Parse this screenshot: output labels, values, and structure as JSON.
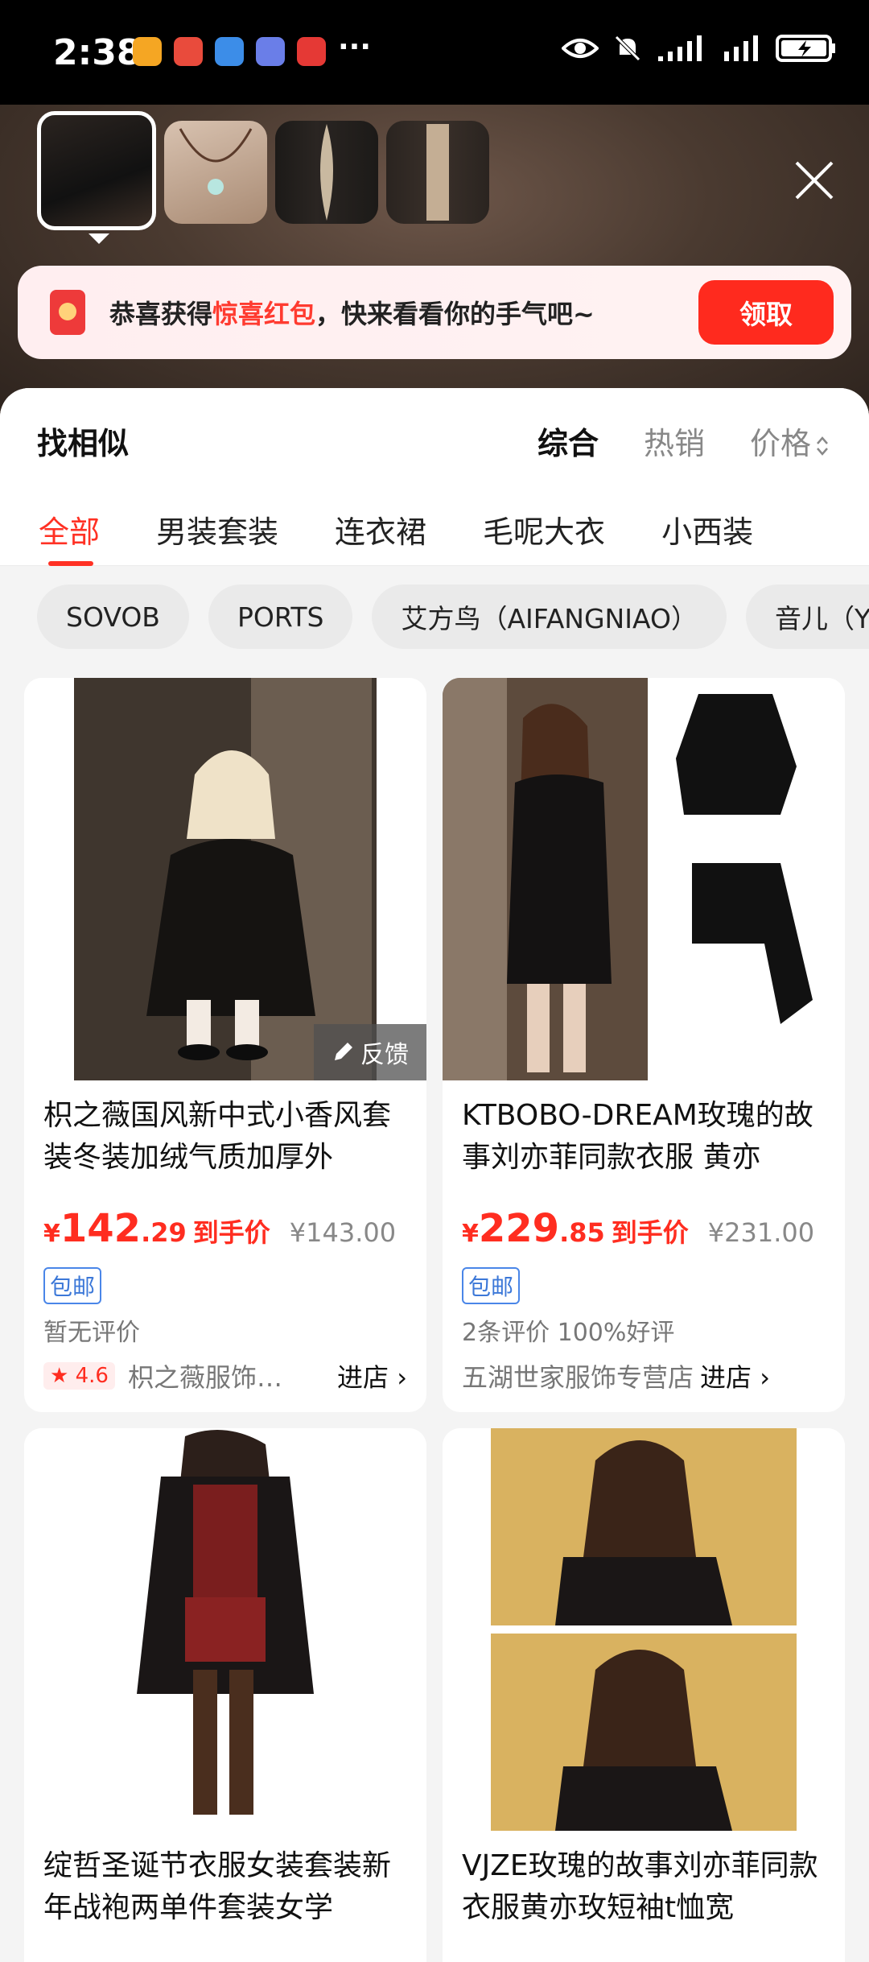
{
  "status_bar": {
    "time": "2:38",
    "more": "···",
    "battery_icon": "battery-charging-icon"
  },
  "thumbnails": [
    {
      "name": "black-outfit"
    },
    {
      "name": "necklace"
    },
    {
      "name": "leaf-pin"
    },
    {
      "name": "bracelet"
    }
  ],
  "promo": {
    "text_before": "恭喜获得",
    "highlight": "惊喜红包",
    "text_after": "，快来看看你的手气吧~",
    "button": "领取",
    "accent": "#ff2a1e"
  },
  "sheet": {
    "title": "找相似",
    "sorts": [
      "综合",
      "热销",
      "价格"
    ],
    "categories": [
      "全部",
      "男装套装",
      "连衣裙",
      "毛呢大衣",
      "小西装"
    ],
    "brands": [
      "SOVOB",
      "PORTS",
      "艾方鸟（AIFANGNIAO）",
      "音儿（Y"
    ]
  },
  "products": [
    {
      "title": "枳之薇国风新中式小香风套装冬装加绒气质加厚外",
      "price_cur": "¥",
      "price_int": "142",
      "price_dec": ".29",
      "price_tag": "到手价",
      "orig_price": "¥143.00",
      "badge": "包邮",
      "reviews": "暂无评价",
      "rating": "4.6",
      "shop": "枳之薇服饰…",
      "enter": "进店",
      "feedback": "反馈"
    },
    {
      "title": "KTBOBO-DREAM玫瑰的故事刘亦菲同款衣服 黄亦",
      "price_cur": "¥",
      "price_int": "229",
      "price_dec": ".85",
      "price_tag": "到手价",
      "orig_price": "¥231.00",
      "badge": "包邮",
      "reviews": "2条评价  100%好评",
      "shop": "五湖世家服饰专营店",
      "enter": "进店"
    },
    {
      "title": "绽哲圣诞节衣服女装套装新年战袍两单件套装女学"
    },
    {
      "title": "VJZE玫瑰的故事刘亦菲同款衣服黄亦玫短袖t恤宽"
    }
  ]
}
